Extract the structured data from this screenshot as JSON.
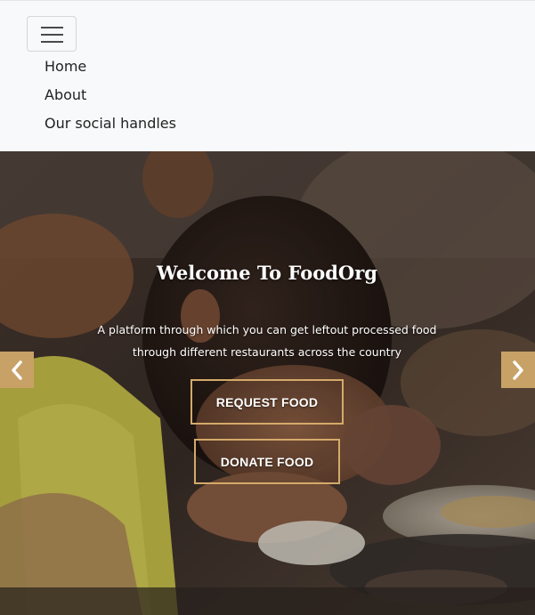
{
  "navbar": {
    "toggler_icon": "hamburger-menu-icon",
    "links": [
      "Home",
      "About",
      "Our social handles"
    ]
  },
  "hero": {
    "title": "Welcome To FoodOrg",
    "subtitle": "A platform through which you can get leftout processed food through different restaurants across the country",
    "buttons": {
      "request": "REQUEST FOOD",
      "donate": "DONATE FOOD"
    },
    "carousel": {
      "prev_icon": "chevron-left-icon",
      "next_icon": "chevron-right-icon"
    }
  },
  "colors": {
    "navbar_bg": "#f8f9fa",
    "accent": "#c8a167",
    "button_border": "#d4aa6a"
  }
}
